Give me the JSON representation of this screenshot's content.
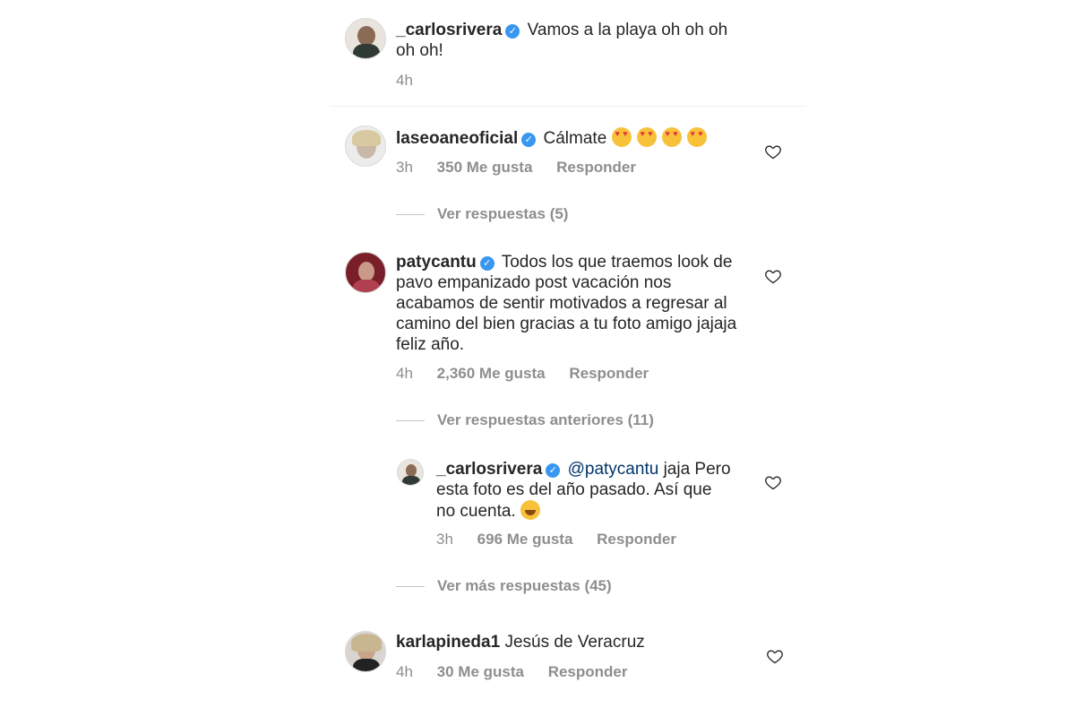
{
  "caption": {
    "username": "_carlosrivera",
    "text": "Vamos a la playa oh oh oh oh oh!",
    "time": "4h"
  },
  "comments": [
    {
      "username": "laseoaneoficial",
      "text": "Cálmate",
      "time": "3h",
      "likes": "350 Me gusta",
      "reply": "Responder",
      "view_replies": "Ver respuestas (5)"
    },
    {
      "username": "patycantu",
      "text": "Todos los que traemos look de pavo empanizado post vacación nos acabamos de sentir motivados a regresar al camino del bien gracias a tu foto amigo jajaja feliz año.",
      "time": "4h",
      "likes": "2,360 Me gusta",
      "reply": "Responder",
      "view_previous": "Ver respuestas anteriores (11)",
      "nested_reply": {
        "username": "_carlosrivera",
        "mention": "@patycantu",
        "text": "jaja Pero esta foto es del año pasado. Así que no cuenta.",
        "time": "3h",
        "likes": "696 Me gusta",
        "reply": "Responder"
      },
      "view_more": "Ver más respuestas (45)"
    },
    {
      "username": "karlapineda1",
      "text": "Jesús de Veracruz",
      "time": "4h",
      "likes": "30 Me gusta",
      "reply": "Responder"
    }
  ],
  "colors": {
    "verified": "#3897f0",
    "meta_text": "#8e8e8e",
    "primary_text": "#262626"
  },
  "icons": [
    "verified-badge-icon",
    "heart-icon",
    "heart-eyes-emoji",
    "laughing-emoji"
  ]
}
